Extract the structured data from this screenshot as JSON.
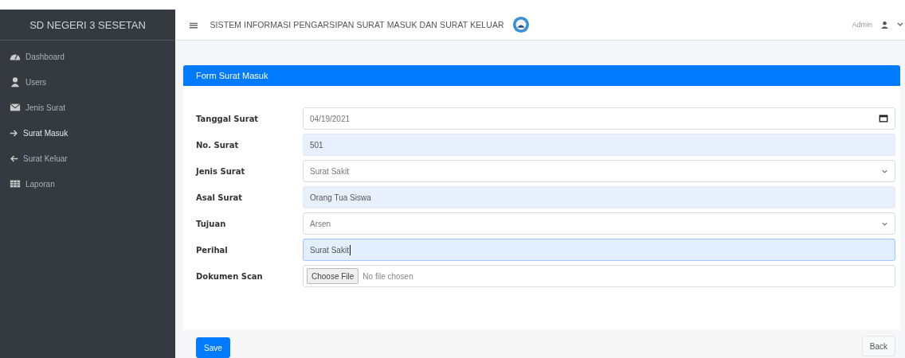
{
  "sidebar": {
    "brand": "SD NEGERI 3 SESETAN",
    "items": [
      {
        "label": "Dashboard",
        "kind": "dashboard",
        "selected": false
      },
      {
        "label": "Users",
        "kind": "user",
        "selected": false
      },
      {
        "label": "Jenis Surat",
        "kind": "envelope",
        "selected": false
      },
      {
        "label": "Surat Masuk",
        "kind": "arrow-right",
        "selected": true
      },
      {
        "label": "Surat Keluar",
        "kind": "arrow-left",
        "selected": false
      },
      {
        "label": "Laporan",
        "kind": "table",
        "selected": false
      }
    ]
  },
  "header": {
    "menu_glyph": "≡",
    "title": "SISTEM INFORMASI PENGARSIPAN SURAT MASUK DAN SURAT KELUAR",
    "user": "Admin"
  },
  "form": {
    "title": "Form Surat Masuk",
    "fields": [
      {
        "label": "Tanggal Surat",
        "kind": "date",
        "value": "04/19/2021",
        "autofilled": false,
        "focused": false
      },
      {
        "label": "No. Surat",
        "kind": "text",
        "value": "501",
        "autofilled": true,
        "focused": false
      },
      {
        "label": "Jenis Surat",
        "kind": "select",
        "value": "Surat Sakit",
        "autofilled": false,
        "focused": false
      },
      {
        "label": "Asal Surat",
        "kind": "text",
        "value": "Orang Tua Siswa",
        "autofilled": true,
        "focused": false
      },
      {
        "label": "Tujuan",
        "kind": "select",
        "value": "Arsen",
        "autofilled": false,
        "focused": false
      },
      {
        "label": "Perihal",
        "kind": "text",
        "value": "Surat Sakit",
        "autofilled": true,
        "focused": true
      },
      {
        "label": "Dokumen Scan",
        "kind": "file",
        "button": "Choose File",
        "value": "No file chosen",
        "autofilled": false,
        "focused": false
      }
    ],
    "buttons": [
      {
        "label": "Save",
        "kind": "primary"
      },
      {
        "label": "Back",
        "kind": "secondary"
      }
    ]
  }
}
